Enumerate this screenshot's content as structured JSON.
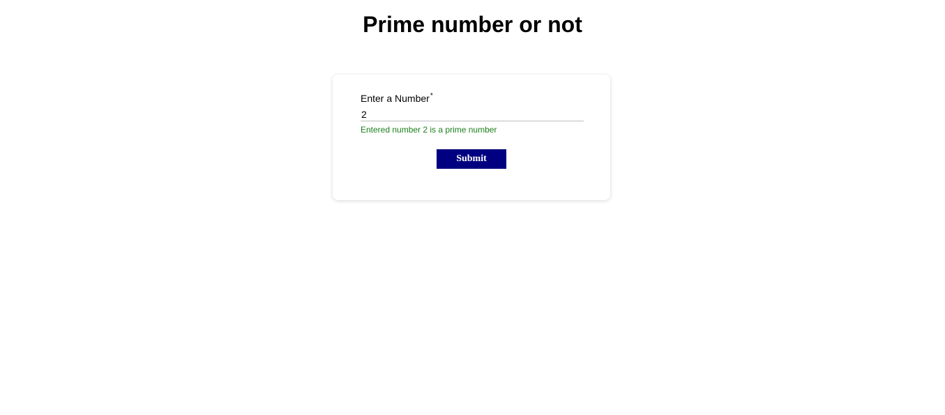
{
  "header": {
    "title": "Prime number or not"
  },
  "form": {
    "label": "Enter a Number",
    "required_mark": "*",
    "input_value": "2",
    "result_message": "Entered number 2 is a prime number",
    "submit_label": "Submit"
  },
  "colors": {
    "success_text": "#1a7f1a",
    "button_background": "#000080",
    "button_text": "#ffffff"
  }
}
